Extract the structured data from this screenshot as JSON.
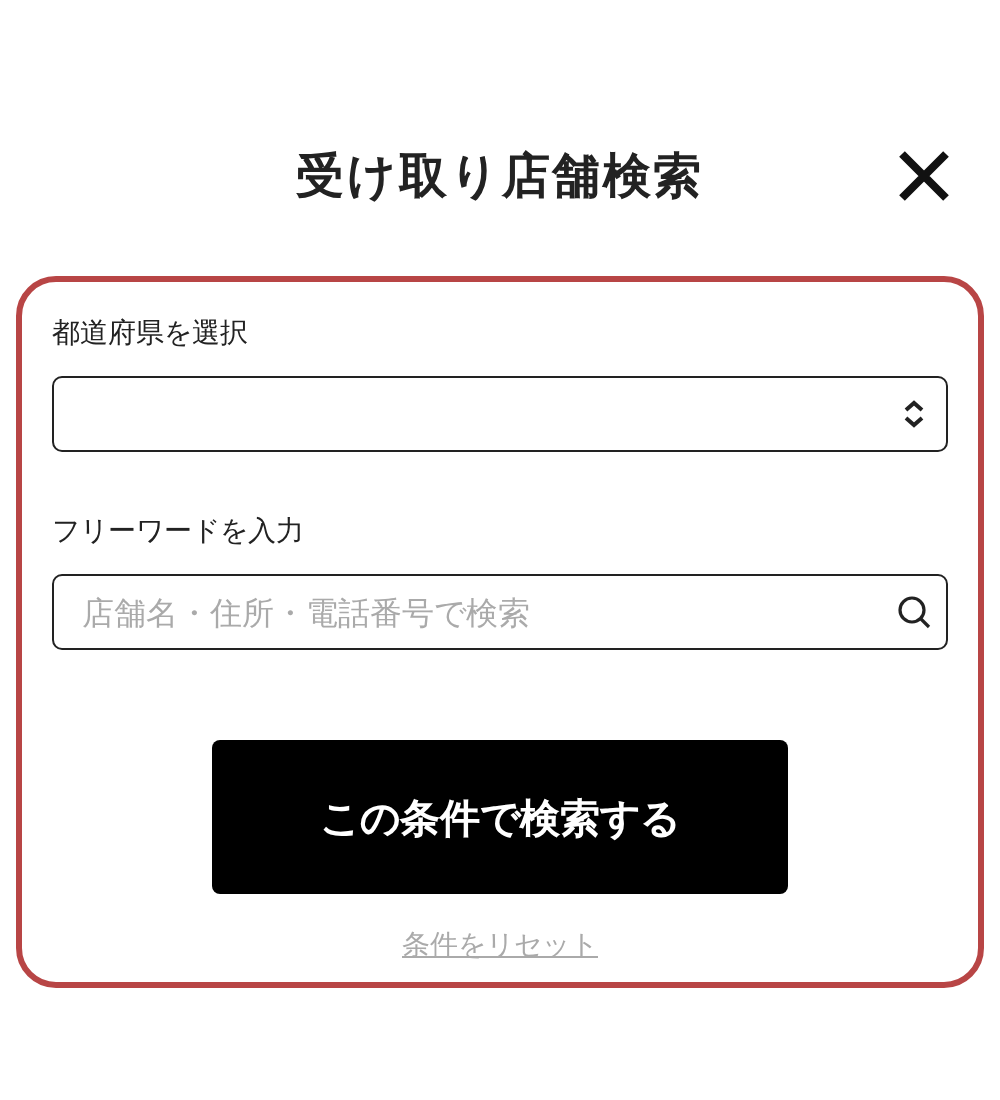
{
  "dialog": {
    "title": "受け取り店舗検索"
  },
  "form": {
    "prefecture_label": "都道府県を選択",
    "freeword_label": "フリーワードを入力",
    "freeword": {
      "placeholder": "店舗名・住所・電話番号で検索"
    },
    "search_button": "この条件で検索する",
    "reset_link": "条件をリセット"
  }
}
